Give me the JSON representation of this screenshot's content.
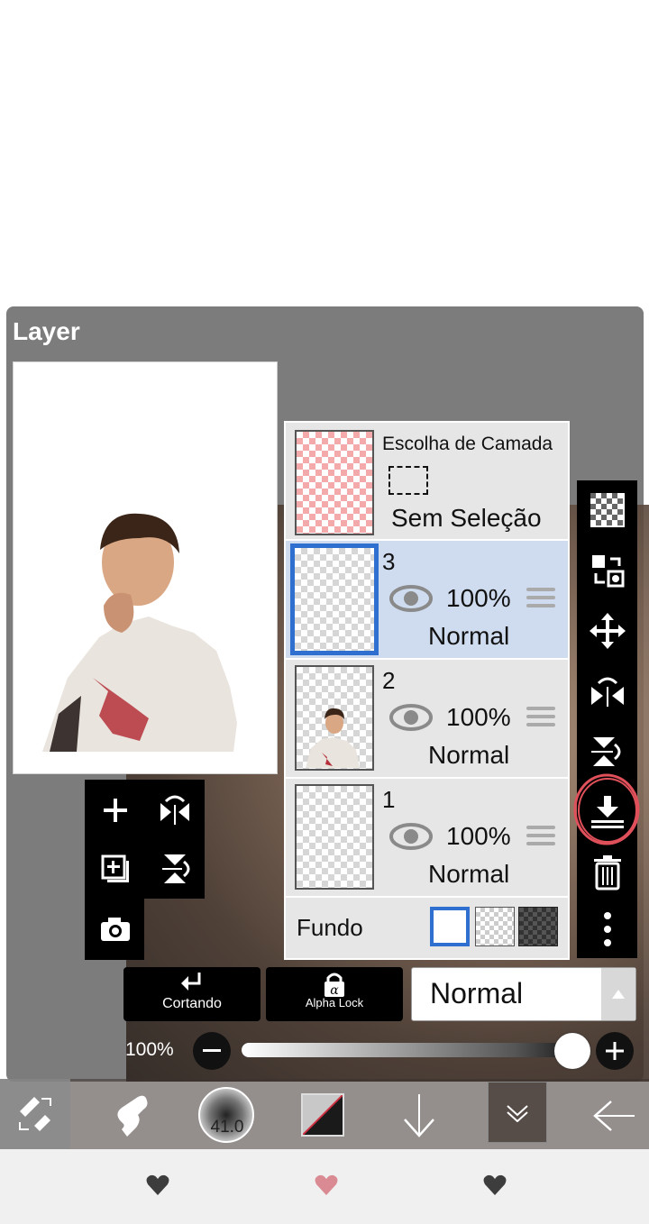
{
  "panel": {
    "title": "Layer"
  },
  "selection": {
    "header": "Escolha de Camada",
    "status": "Sem Seleção"
  },
  "layers": [
    {
      "number": "3",
      "opacity": "100%",
      "blend": "Normal",
      "selected": true
    },
    {
      "number": "2",
      "opacity": "100%",
      "blend": "Normal",
      "selected": false
    },
    {
      "number": "1",
      "opacity": "100%",
      "blend": "Normal",
      "selected": false
    }
  ],
  "background": {
    "label": "Fundo"
  },
  "controls": {
    "clipping_label": "Cortando",
    "alpha_lock_label": "Alpha Lock",
    "blend_mode": "Normal",
    "opacity_label": "100%",
    "opacity_value": 1.0
  },
  "tools": {
    "brush_size": "41.0"
  },
  "colors": {
    "accent_blue": "#2f6fd0",
    "panel_gray": "#7c7c7c",
    "highlight_red": "#e0505a",
    "selected_row": "#cfdcef"
  },
  "icons": {
    "left_toolbox": [
      "plus-icon",
      "flip-horizontal-icon",
      "add-layer-icon",
      "flip-vertical-icon",
      "camera-icon"
    ],
    "right_toolbar": [
      "checker-icon",
      "transfer-icon",
      "move-icon",
      "flip-horizontal-icon",
      "flip-vertical-icon",
      "merge-down-icon",
      "trash-icon",
      "more-icon"
    ],
    "bottom": [
      "tool-switch-icon",
      "finger-icon",
      "brush-size-icon",
      "color-icon",
      "arrow-down-icon",
      "layer-menu-icon",
      "back-arrow-icon"
    ],
    "nav": [
      "heart-icon",
      "heart-icon",
      "heart-icon"
    ]
  }
}
